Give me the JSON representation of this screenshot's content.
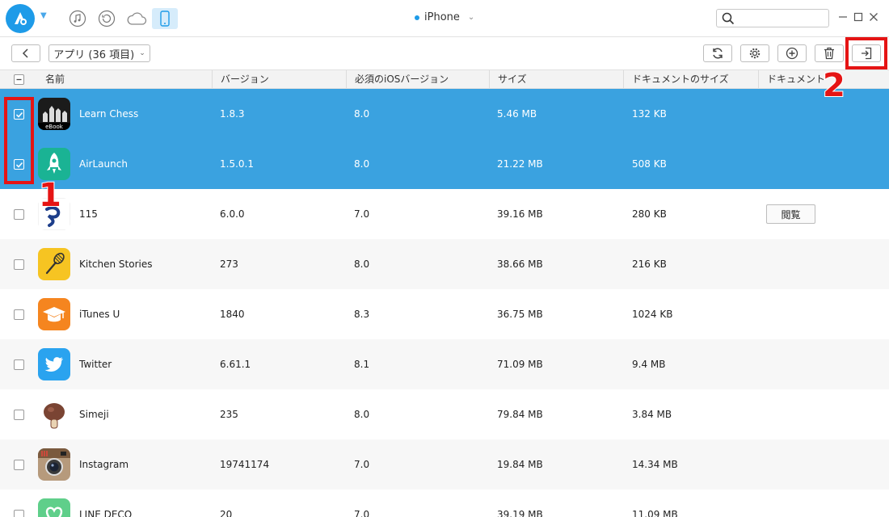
{
  "topbar": {
    "device_name": "iPhone",
    "search_placeholder": "",
    "colors": {
      "accent": "#1e9be8",
      "selected_row": "#3aa2e0",
      "annotation": "#e51414"
    }
  },
  "toolbar": {
    "category_label": "アプリ (36 項目)"
  },
  "table": {
    "headers": [
      "名前",
      "バージョン",
      "必須のiOSバージョン",
      "サイズ",
      "ドキュメントのサイズ",
      "ドキュメント"
    ],
    "rows": [
      {
        "name": "Learn Chess",
        "version": "1.8.3",
        "ios": "8.0",
        "size": "5.46 MB",
        "doc_size": "132 KB",
        "doc": "",
        "selected": true,
        "icon": "learn-chess-icon"
      },
      {
        "name": "AirLaunch",
        "version": "1.5.0.1",
        "ios": "8.0",
        "size": "21.22 MB",
        "doc_size": "508 KB",
        "doc": "",
        "selected": true,
        "icon": "airlaunch-icon"
      },
      {
        "name": "115",
        "version": "6.0.0",
        "ios": "7.0",
        "size": "39.16 MB",
        "doc_size": "280 KB",
        "doc": "閲覧",
        "selected": false,
        "icon": "app-115-icon"
      },
      {
        "name": "Kitchen Stories",
        "version": "273",
        "ios": "8.0",
        "size": "38.66 MB",
        "doc_size": "216 KB",
        "doc": "",
        "selected": false,
        "icon": "kitchen-stories-icon"
      },
      {
        "name": "iTunes U",
        "version": "1840",
        "ios": "8.3",
        "size": "36.75 MB",
        "doc_size": "1024 KB",
        "doc": "",
        "selected": false,
        "icon": "itunes-u-icon"
      },
      {
        "name": "Twitter",
        "version": "6.61.1",
        "ios": "8.1",
        "size": "71.09 MB",
        "doc_size": "9.4 MB",
        "doc": "",
        "selected": false,
        "icon": "twitter-icon"
      },
      {
        "name": "Simeji",
        "version": "235",
        "ios": "8.0",
        "size": "79.84 MB",
        "doc_size": "3.84 MB",
        "doc": "",
        "selected": false,
        "icon": "simeji-icon"
      },
      {
        "name": "Instagram",
        "version": "19741174",
        "ios": "7.0",
        "size": "19.84 MB",
        "doc_size": "14.34 MB",
        "doc": "",
        "selected": false,
        "icon": "instagram-icon"
      },
      {
        "name": "LINE DECO",
        "version": "20",
        "ios": "7.0",
        "size": "39.19 MB",
        "doc_size": "11.09 MB",
        "doc": "",
        "selected": false,
        "icon": "line-deco-icon"
      }
    ]
  },
  "annotations": {
    "step1": "1",
    "step2": "2"
  }
}
